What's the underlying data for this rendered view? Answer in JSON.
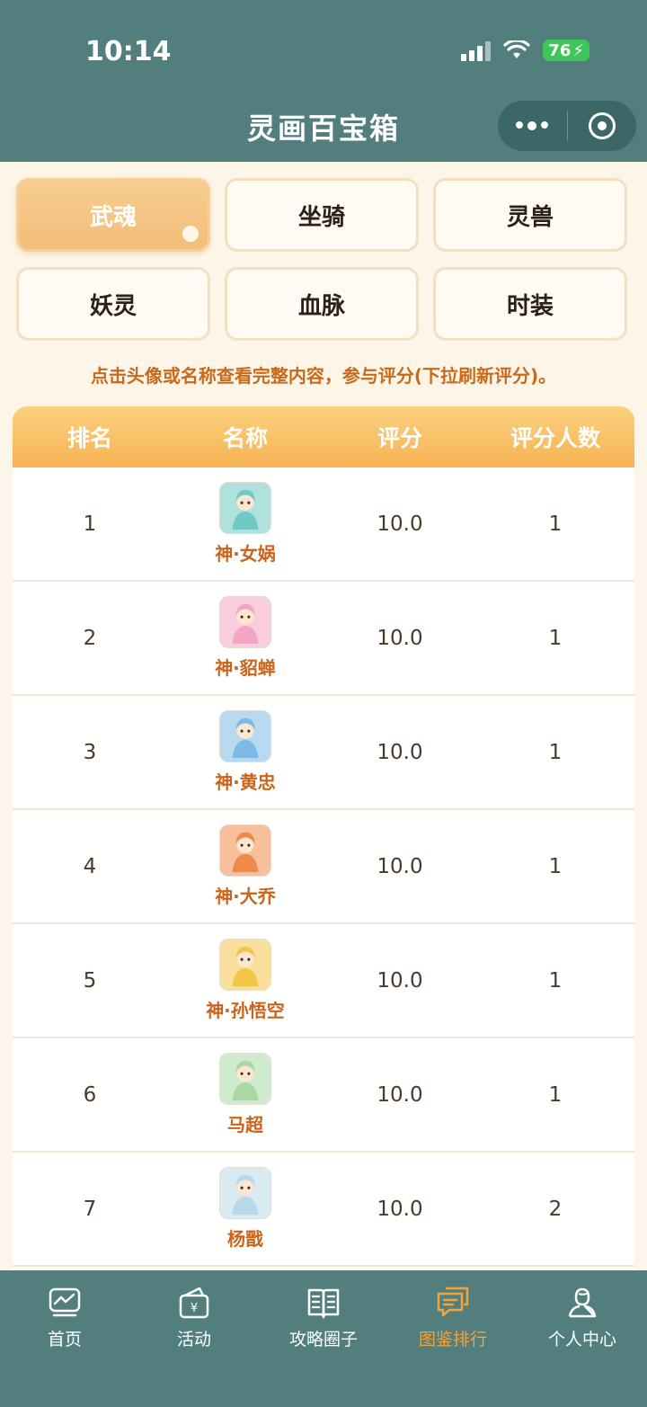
{
  "status": {
    "time": "10:14",
    "battery": "76"
  },
  "header": {
    "title": "灵画百宝箱"
  },
  "categories": [
    {
      "label": "武魂",
      "active": true
    },
    {
      "label": "坐骑",
      "active": false
    },
    {
      "label": "灵兽",
      "active": false
    },
    {
      "label": "妖灵",
      "active": false
    },
    {
      "label": "血脉",
      "active": false
    },
    {
      "label": "时装",
      "active": false
    }
  ],
  "hint": "点击头像或名称查看完整内容，参与评分(下拉刷新评分)。",
  "table": {
    "headers": [
      "排名",
      "名称",
      "评分",
      "评分人数"
    ],
    "rows": [
      {
        "rank": "1",
        "name": "神·女娲",
        "score": "10.0",
        "count": "1",
        "avatar_color": "#6fc9c4"
      },
      {
        "rank": "2",
        "name": "神·貂蝉",
        "score": "10.0",
        "count": "1",
        "avatar_color": "#f3a6c4"
      },
      {
        "rank": "3",
        "name": "神·黄忠",
        "score": "10.0",
        "count": "1",
        "avatar_color": "#7dbbe6"
      },
      {
        "rank": "4",
        "name": "神·大乔",
        "score": "10.0",
        "count": "1",
        "avatar_color": "#f08a4a"
      },
      {
        "rank": "5",
        "name": "神·孙悟空",
        "score": "10.0",
        "count": "1",
        "avatar_color": "#f3c64a"
      },
      {
        "rank": "6",
        "name": "马超",
        "score": "10.0",
        "count": "1",
        "avatar_color": "#a9d8a4"
      },
      {
        "rank": "7",
        "name": "杨戬",
        "score": "10.0",
        "count": "2",
        "avatar_color": "#b9d9ea"
      }
    ]
  },
  "tabbar": [
    {
      "label": "首页",
      "icon": "home-chart-icon",
      "active": false
    },
    {
      "label": "活动",
      "icon": "wallet-icon",
      "active": false
    },
    {
      "label": "攻略圈子",
      "icon": "book-icon",
      "active": false
    },
    {
      "label": "图鉴排行",
      "icon": "chat-icon",
      "active": true
    },
    {
      "label": "个人中心",
      "icon": "user-icon",
      "active": false
    }
  ],
  "colors": {
    "header": "#527f7e",
    "accent": "#f6b353",
    "active_tab": "#f2a33c",
    "name_text": "#c9641a"
  }
}
